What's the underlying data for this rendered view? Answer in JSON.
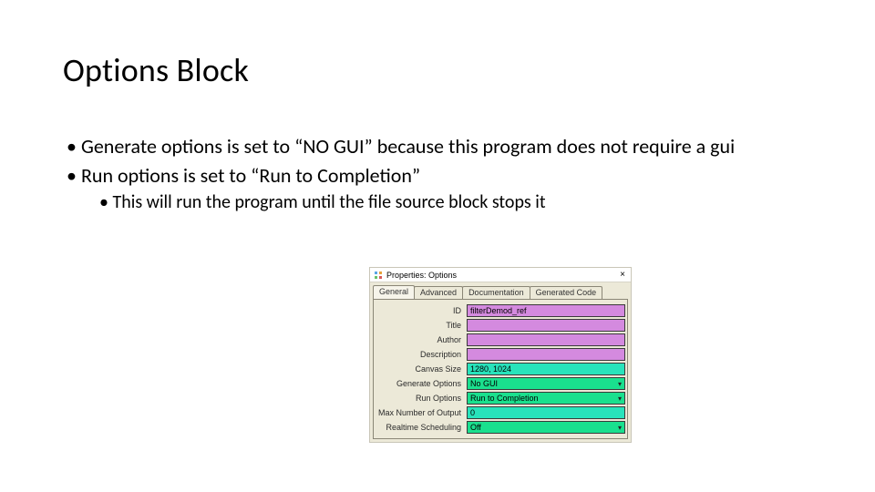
{
  "title": "Options Block",
  "bullets": {
    "b1a": "Generate options is set to “NO GUI” because this program does not require a gui",
    "b1b": "Run options is set to “Run to Completion”",
    "b2a": "This will run the program until the file source block stops it"
  },
  "dialog": {
    "title": "Properties: Options",
    "close": "×",
    "tabs": {
      "general": "General",
      "advanced": "Advanced",
      "documentation": "Documentation",
      "generated": "Generated Code"
    },
    "rows": {
      "id": {
        "label": "ID",
        "value": "filterDemod_ref"
      },
      "title": {
        "label": "Title",
        "value": ""
      },
      "author": {
        "label": "Author",
        "value": ""
      },
      "desc": {
        "label": "Description",
        "value": ""
      },
      "canvas": {
        "label": "Canvas Size",
        "value": "1280, 1024"
      },
      "genopt": {
        "label": "Generate Options",
        "value": "No GUI"
      },
      "runopt": {
        "label": "Run Options",
        "value": "Run to Completion"
      },
      "maxout": {
        "label": "Max Number of Output",
        "value": "0"
      },
      "realtime": {
        "label": "Realtime Scheduling",
        "value": "Off"
      }
    },
    "caret": "▾"
  }
}
